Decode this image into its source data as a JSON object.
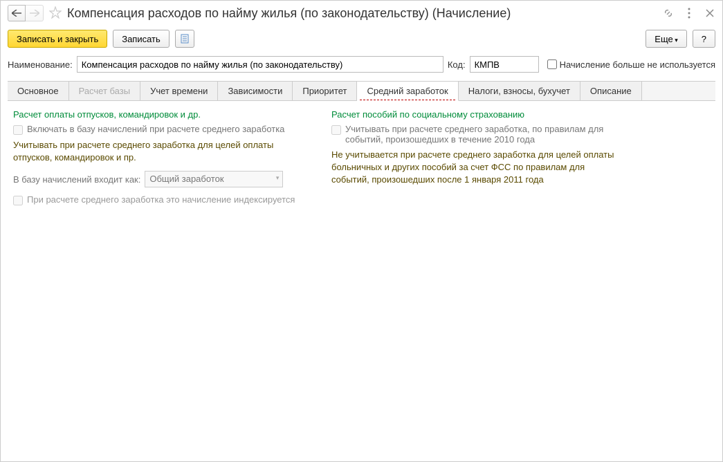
{
  "title": "Компенсация расходов по найму жилья (по законодательству) (Начисление)",
  "toolbar": {
    "save_close": "Записать и закрыть",
    "save": "Записать",
    "more": "Еще",
    "help": "?"
  },
  "form": {
    "name_label": "Наименование:",
    "name_value": "Компенсация расходов по найму жилья (по законодательству)",
    "code_label": "Код:",
    "code_value": "КМПВ",
    "unused_label": "Начисление больше не используется"
  },
  "tabs": {
    "main": "Основное",
    "base": "Расчет базы",
    "time": "Учет времени",
    "deps": "Зависимости",
    "priority": "Приоритет",
    "avg": "Средний заработок",
    "taxes": "Налоги, взносы, бухучет",
    "desc": "Описание"
  },
  "left": {
    "section": "Расчет оплаты отпусков, командировок и др.",
    "check1": "Включать в базу начислений при расчете среднего заработка",
    "desc1": "Учитывать при расчете среднего заработка для целей оплаты отпусков, командировок и пр.",
    "as_label": "В базу начислений входит как:",
    "as_value": "Общий заработок",
    "check2": "При расчете среднего заработка это начисление индексируется"
  },
  "right": {
    "section": "Расчет пособий по социальному страхованию",
    "check1": "Учитывать при расчете среднего заработка, по правилам для событий, произошедших в течение 2010 года",
    "desc1": "Не учитывается при расчете среднего заработка для целей оплаты больничных и других пособий за счет ФСС по правилам для событий, произошедших после 1 января 2011 года"
  }
}
